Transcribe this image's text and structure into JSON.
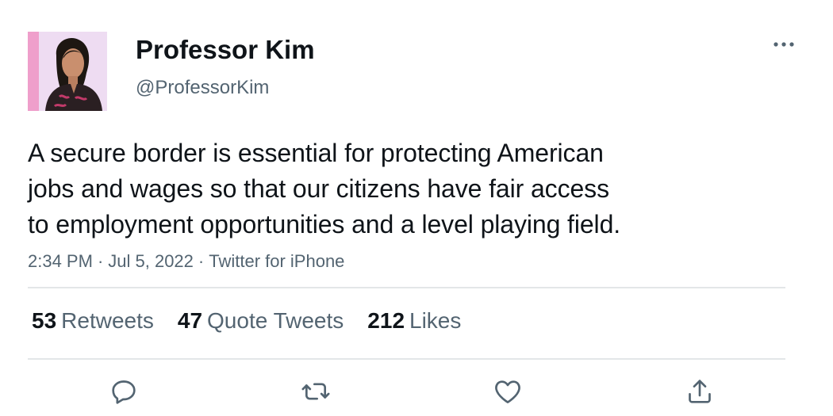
{
  "author": {
    "display_name": "Professor Kim",
    "handle": "@ProfessorKim"
  },
  "tweet": {
    "text": "A secure border is essential for protecting American\njobs and wages so that our citizens have fair access\nto employment opportunities and a level playing field.",
    "time": "2:34 PM",
    "date": "Jul 5, 2022",
    "source": "Twitter for iPhone",
    "separator": "·"
  },
  "stats": [
    {
      "count": "53",
      "label": "Retweets"
    },
    {
      "count": "47",
      "label": "Quote Tweets"
    },
    {
      "count": "212",
      "label": "Likes"
    }
  ],
  "icons": {
    "more": "more-horizontal-icon",
    "reply": "reply-icon",
    "retweet": "retweet-icon",
    "like": "heart-icon",
    "share": "share-icon"
  },
  "colors": {
    "text": "#0f1419",
    "secondary": "#536471",
    "divider": "#e3e6e8",
    "background": "#ffffff"
  }
}
